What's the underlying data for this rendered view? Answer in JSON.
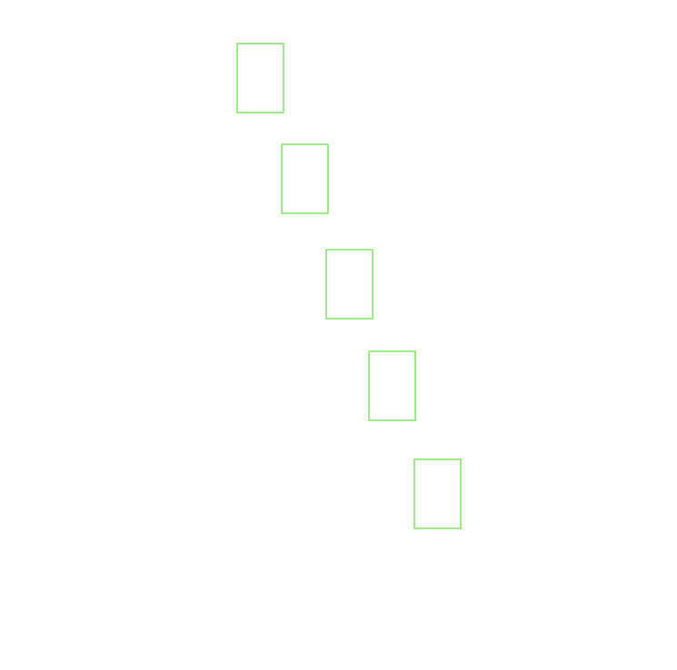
{
  "colors": {
    "background": "#ffffff",
    "box_outline": "#9eea86"
  },
  "boxes": [
    {
      "name": "outline-box-1"
    },
    {
      "name": "outline-box-2"
    },
    {
      "name": "outline-box-3"
    },
    {
      "name": "outline-box-4"
    },
    {
      "name": "outline-box-5"
    }
  ]
}
